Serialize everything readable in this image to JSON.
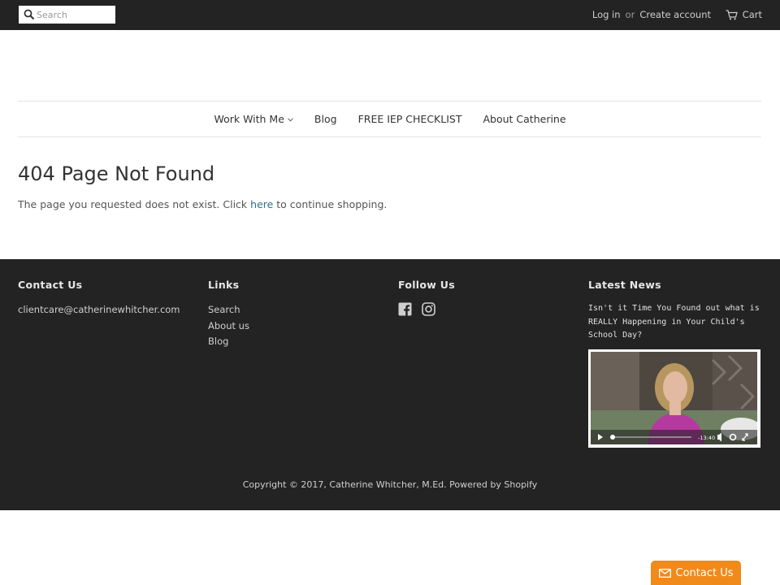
{
  "topbar": {
    "search_placeholder": "Search",
    "login_label": "Log in",
    "or_label": "or",
    "create_account_label": "Create account",
    "cart_label": "Cart"
  },
  "nav": {
    "items": [
      {
        "label": "Work With Me",
        "has_dropdown": true
      },
      {
        "label": "Blog"
      },
      {
        "label": "FREE IEP CHECKLIST"
      },
      {
        "label": "About Catherine"
      }
    ]
  },
  "main": {
    "title": "404 Page Not Found",
    "text_before": "The page you requested does not exist. Click ",
    "link_label": "here",
    "text_after": " to continue shopping."
  },
  "footer": {
    "contact": {
      "heading": "Contact Us",
      "email": "clientcare@catherinewhitcher.com"
    },
    "links": {
      "heading": "Links",
      "items": [
        "Search",
        "About us",
        "Blog"
      ]
    },
    "follow": {
      "heading": "Follow Us",
      "icons": [
        "facebook-icon",
        "instagram-icon"
      ]
    },
    "news": {
      "heading": "Latest News",
      "post_title": "Isn't it Time You Found out what is REALLY Happening in Your Child's School Day?",
      "video_time": "-13:40"
    },
    "copyright": "Copyright © 2017, Catherine Whitcher, M.Ed. Powered by Shopify"
  },
  "contact_widget": {
    "label": "Contact Us"
  },
  "colors": {
    "topbar_bg": "#232323",
    "footer_bg": "#232323",
    "link": "#2f6f8f",
    "widget": "#f08a1b"
  }
}
